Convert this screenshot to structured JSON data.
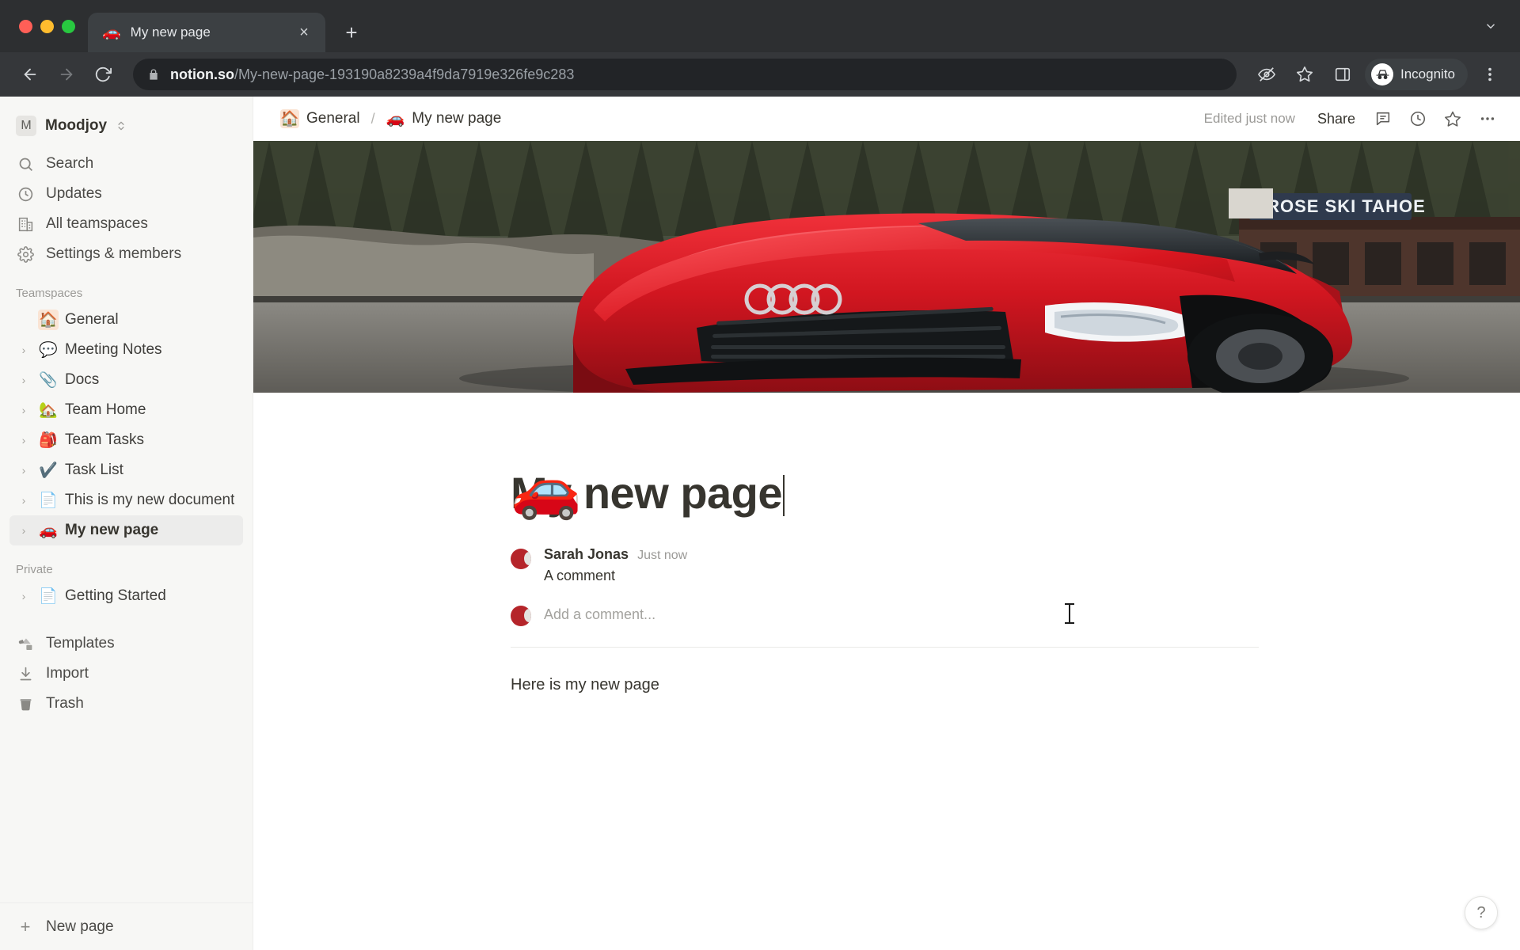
{
  "browser": {
    "tab": {
      "favicon": "car-emoji",
      "title": "My new page",
      "close_label": "×"
    },
    "new_tab_label": "+",
    "tab_list_chevron": "chevron-down-icon",
    "back_label": "←",
    "forward_label": "→",
    "reload_label": "⟳",
    "url_host": "notion.so",
    "url_path": "/My-new-page-193190a8239a4f9da7919e326fe9c283",
    "profile_label": "Incognito"
  },
  "sidebar": {
    "workspace": {
      "initial": "M",
      "name": "Moodjoy"
    },
    "nav": [
      {
        "icon": "search-icon",
        "label": "Search"
      },
      {
        "icon": "clock-icon",
        "label": "Updates"
      },
      {
        "icon": "building-icon",
        "label": "All teamspaces"
      },
      {
        "icon": "gear-icon",
        "label": "Settings & members"
      }
    ],
    "teamspaces_title": "Teamspaces",
    "teamspaces": [
      {
        "emoji": "🏠",
        "label": "General",
        "twisty": false,
        "boxed": true,
        "selected": false
      },
      {
        "emoji": "💬",
        "label": "Meeting Notes",
        "twisty": true,
        "boxed": false,
        "selected": false
      },
      {
        "emoji": "📎",
        "label": "Docs",
        "twisty": true,
        "boxed": false,
        "selected": false
      },
      {
        "emoji": "🏡",
        "label": "Team Home",
        "twisty": true,
        "boxed": false,
        "selected": false
      },
      {
        "emoji": "🎒",
        "label": "Team Tasks",
        "twisty": true,
        "boxed": false,
        "selected": false
      },
      {
        "emoji": "✔️",
        "label": "Task List",
        "twisty": true,
        "boxed": false,
        "selected": false
      },
      {
        "emoji": "📄",
        "label": "This is my new document",
        "twisty": true,
        "boxed": false,
        "selected": false
      },
      {
        "emoji": "🚗",
        "label": "My new page",
        "twisty": true,
        "boxed": false,
        "selected": true
      }
    ],
    "private_title": "Private",
    "private": [
      {
        "emoji": "📄",
        "label": "Getting Started",
        "twisty": true,
        "boxed": false,
        "selected": false
      }
    ],
    "tools": [
      {
        "icon": "templates-icon",
        "label": "Templates"
      },
      {
        "icon": "import-icon",
        "label": "Import"
      },
      {
        "icon": "trash-icon",
        "label": "Trash"
      }
    ],
    "footer": {
      "icon": "plus-icon",
      "label": "New page"
    }
  },
  "topbar": {
    "breadcrumb": [
      {
        "emoji": "🏠",
        "label": "General",
        "boxed": true
      },
      {
        "emoji": "🚗",
        "label": "My new page",
        "boxed": false
      }
    ],
    "separator": "/",
    "edited": "Edited just now",
    "share_label": "Share",
    "icons": [
      {
        "name": "comment-icon"
      },
      {
        "name": "history-clock-icon"
      },
      {
        "name": "star-icon"
      },
      {
        "name": "more-options-icon"
      }
    ]
  },
  "page": {
    "cover_alt": "red-sports-car-cover-image",
    "cover_sign_text": "MT ROSE SKI TAHOE",
    "emoji": "🚗",
    "title": "My new page",
    "comments": [
      {
        "author": "Sarah Jonas",
        "time": "Just now",
        "text": "A comment"
      }
    ],
    "add_comment_placeholder": "Add a comment...",
    "body": "Here is my new page"
  },
  "help": {
    "label": "?"
  }
}
